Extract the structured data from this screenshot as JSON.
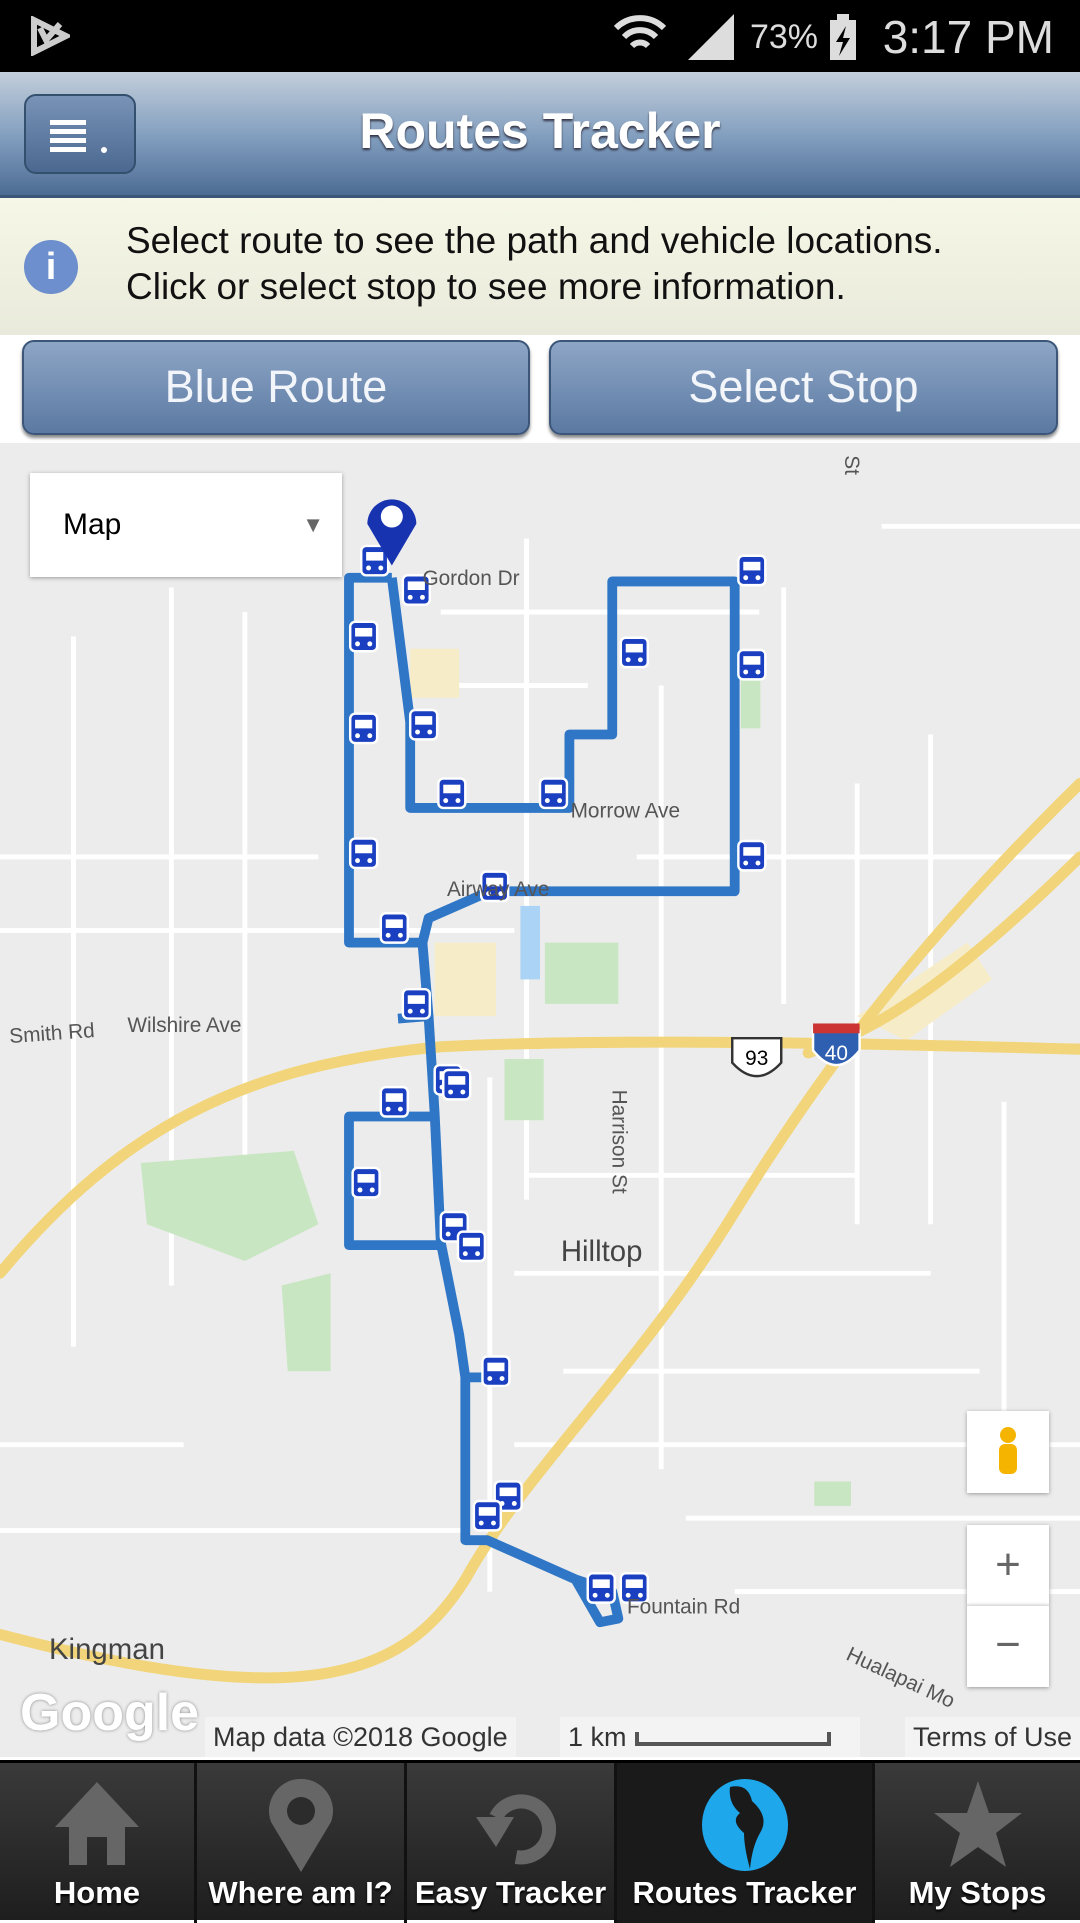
{
  "status_bar": {
    "battery": "73%",
    "time": "3:17 PM",
    "icons": [
      "app-notification-icon",
      "wifi-icon",
      "signal-icon",
      "battery-charging-icon"
    ]
  },
  "header": {
    "title": "Routes Tracker",
    "menu_icon": "list-menu-icon"
  },
  "info": {
    "line1": "Select route to see the path and vehicle locations.",
    "line2": "Click or select stop to see more information.",
    "icon": "info-icon"
  },
  "buttons": {
    "route": "Blue Route",
    "stop": "Select Stop"
  },
  "map": {
    "type_selector": "Map",
    "labels": {
      "gordon": "Gordon Dr",
      "morrow": "Morrow Ave",
      "airway": "Airway Ave",
      "smith": "Smith Rd",
      "wilshire": "Wilshire Ave",
      "harrison": "Harrison St",
      "hilltop": "Hilltop",
      "kingman": "Kingman",
      "fountain": "Fountain Rd",
      "hualapai": "Hualapai Mo",
      "st": "St",
      "us93": "93",
      "i40": "40"
    },
    "zoom_in": "+",
    "zoom_out": "−",
    "attribution": "Map data ©2018 Google",
    "scale": "1 km",
    "terms": "Terms of Use",
    "logo": "Google",
    "route_color": "#2f76c6"
  },
  "nav": [
    {
      "label": "Home",
      "icon": "home-icon"
    },
    {
      "label": "Where am I?",
      "icon": "location-pin-icon"
    },
    {
      "label": "Easy Tracker",
      "icon": "refresh-icon"
    },
    {
      "label": "Routes Tracker",
      "icon": "globe-icon",
      "active": true
    },
    {
      "label": "My Stops",
      "icon": "star-icon"
    }
  ]
}
